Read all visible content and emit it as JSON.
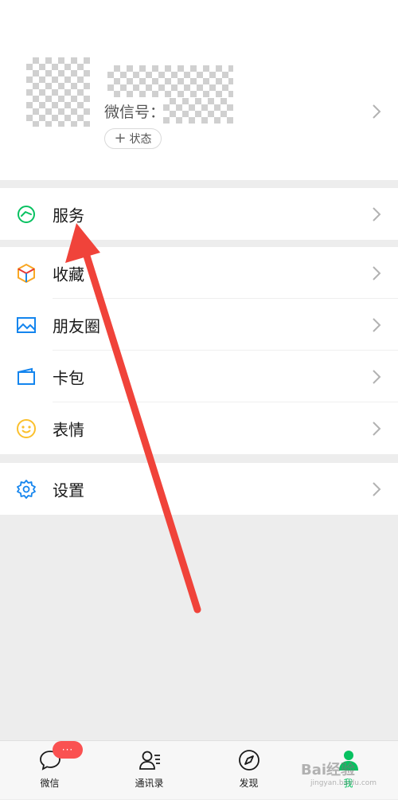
{
  "profile": {
    "wechat_id_label": "微信号：",
    "status_button_label": "状态",
    "status_button_icon": "plus-icon"
  },
  "menu": {
    "service": {
      "label": "服务",
      "icon": "service-wallet-icon",
      "color": "#07c160"
    },
    "favorites": {
      "label": "收藏",
      "icon": "favorites-cube-icon"
    },
    "moments": {
      "label": "朋友圈",
      "icon": "moments-photo-icon",
      "color": "#1485ee"
    },
    "cards": {
      "label": "卡包",
      "icon": "card-wallet-icon",
      "color": "#1485ee"
    },
    "stickers": {
      "label": "表情",
      "icon": "sticker-smiley-icon",
      "color": "#fbc02d"
    },
    "settings": {
      "label": "设置",
      "icon": "settings-gear-icon",
      "color": "#1485ee"
    }
  },
  "tabbar": {
    "chats": {
      "label": "微信",
      "badge": "···"
    },
    "contacts": {
      "label": "通讯录"
    },
    "discover": {
      "label": "发现"
    },
    "me": {
      "label": "我",
      "active_color": "#07c160"
    }
  },
  "annotation": {
    "arrow_color": "#f0433a"
  },
  "watermark": {
    "text": "Bai经验",
    "sub": "jingyan.baidu.com"
  }
}
